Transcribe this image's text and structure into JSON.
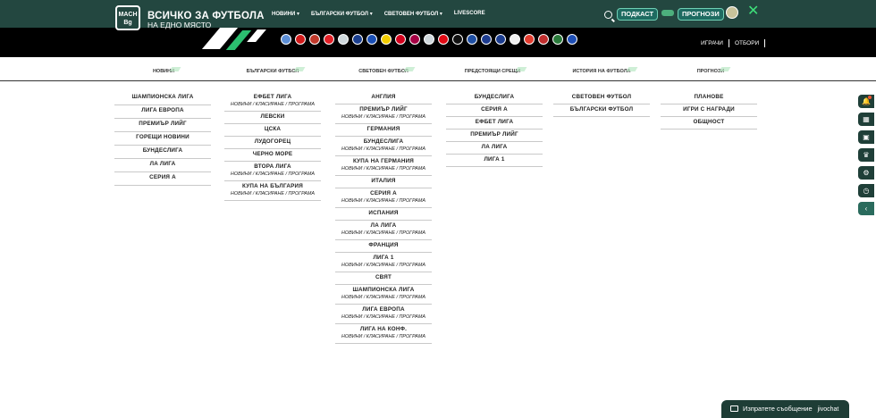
{
  "header": {
    "logo_line1": "MACH",
    "logo_line2": "Bg",
    "brand_title": "ВСИЧКО ЗА ФУТБОЛА",
    "brand_subtitle": "НА ЕДНО МЯСТО",
    "nav": [
      {
        "label": "НОВИНИ",
        "caret": "▾"
      },
      {
        "label": "БЪЛГАРСКИ ФУТБОЛ",
        "caret": "▾"
      },
      {
        "label": "СВЕТОВЕН ФУТБОЛ",
        "caret": "▾"
      },
      {
        "label": "LIVESCORE",
        "caret": ""
      }
    ],
    "podcast_label": "ПОДКАСТ",
    "prognosis_label": "ПРОГНОЗИ",
    "close_glyph": "✕",
    "accent_color": "#3ee07a",
    "bar_color": "#234740"
  },
  "club_bar": {
    "players_label": "ИГРАЧИ",
    "teams_label": "ОТБОРИ",
    "crest_colors": [
      "#5d8fd6",
      "#d11a1a",
      "#c0392b",
      "#e21f26",
      "#cfd8dc",
      "#1b3f8f",
      "#1a4fb5",
      "#f2cd00",
      "#d3001c",
      "#a50044",
      "#cfd8dc",
      "#e10a14",
      "#111111",
      "#1f4fa3",
      "#1e3c8f",
      "#1c3d8f",
      "#f0f0f0",
      "#e23b2e",
      "#c02e2e",
      "#2a7a3b",
      "#1f4fb5"
    ]
  },
  "subtabs": [
    "НОВИНИ",
    "БЪЛГАРСКИ ФУТБОЛ",
    "СВЕТОВЕН ФУТБОЛ",
    "ПРЕДСТОЯЩИ СРЕЩИ",
    "ИСТОРИЯ НА ФУТБОЛА",
    "ПРОГНОЗИ"
  ],
  "sub_links": "НОВИНИ / КЛАСИРАНЕ / ПРОГРАМА",
  "columns": [
    {
      "items": [
        {
          "title": "ШАМПИОНСКА ЛИГА"
        },
        {
          "title": "ЛИГА ЕВРОПА"
        },
        {
          "title": "ПРЕМИЪР ЛИЙГ"
        },
        {
          "title": "ГОРЕЩИ НОВИНИ"
        },
        {
          "title": "БУНДЕСЛИГА"
        },
        {
          "title": "ЛА ЛИГА"
        },
        {
          "title": "СЕРИЯ А"
        }
      ]
    },
    {
      "items": [
        {
          "title": "ЕФБЕТ ЛИГА",
          "sub": "НОВИНИ / КЛАСИРАНЕ / ПРОГРАМА"
        },
        {
          "title": "ЛЕВСКИ"
        },
        {
          "title": "ЦСКА"
        },
        {
          "title": "ЛУДОГОРЕЦ"
        },
        {
          "title": "ЧЕРНО МОРЕ"
        },
        {
          "title": "ВТОРА ЛИГА",
          "sub": "НОВИНИ / КЛАСИРАНЕ / ПРОГРАМА"
        },
        {
          "title": "КУПА НА БЪЛГАРИЯ",
          "sub": "НОВИНИ / КЛАСИРАНЕ / ПРОГРАМА"
        }
      ]
    },
    {
      "items": [
        {
          "title": "АНГЛИЯ"
        },
        {
          "title": "ПРЕМИЪР ЛИЙГ",
          "sub": "НОВИНИ / КЛАСИРАНЕ / ПРОГРАМА"
        },
        {
          "title": "ГЕРМАНИЯ"
        },
        {
          "title": "БУНДЕСЛИГА",
          "sub": "НОВИНИ / КЛАСИРАНЕ / ПРОГРАМА"
        },
        {
          "title": "КУПА НА ГЕРМАНИЯ",
          "sub": "НОВИНИ / КЛАСИРАНЕ / ПРОГРАМА"
        },
        {
          "title": "ИТАЛИЯ"
        },
        {
          "title": "СЕРИЯ А",
          "sub": "НОВИНИ / КЛАСИРАНЕ / ПРОГРАМА"
        },
        {
          "title": "ИСПАНИЯ"
        },
        {
          "title": "ЛА ЛИГА",
          "sub": "НОВИНИ / КЛАСИРАНЕ / ПРОГРАМА"
        },
        {
          "title": "ФРАНЦИЯ"
        },
        {
          "title": "ЛИГА 1",
          "sub": "НОВИНИ / КЛАСИРАНЕ / ПРОГРАМА"
        },
        {
          "title": "СВЯТ"
        },
        {
          "title": "ШАМПИОНСКА ЛИГА",
          "sub": "НОВИНИ / КЛАСИРАНЕ / ПРОГРАМА"
        },
        {
          "title": "ЛИГА ЕВРОПА",
          "sub": "НОВИНИ / КЛАСИРАНЕ / ПРОГРАМА"
        },
        {
          "title": "ЛИГА НА КОНФ.",
          "sub": "НОВИНИ / КЛАСИРАНЕ / ПРОГРАМА"
        }
      ]
    },
    {
      "items": [
        {
          "title": "БУНДЕСЛИГА"
        },
        {
          "title": "СЕРИЯ А"
        },
        {
          "title": "ЕФБЕТ ЛИГА"
        },
        {
          "title": "ПРЕМИЪР ЛИЙГ"
        },
        {
          "title": "ЛА ЛИГА"
        },
        {
          "title": "ЛИГА 1"
        }
      ]
    },
    {
      "items": [
        {
          "title": "СВЕТОВЕН ФУТБОЛ"
        },
        {
          "title": "БЪЛГАРСКИ ФУТБОЛ"
        }
      ]
    },
    {
      "items": [
        {
          "title": "ПЛАНОВЕ"
        },
        {
          "title": "ИГРИ С НАГРАДИ"
        },
        {
          "title": "ОБЩНОСТ"
        }
      ]
    }
  ],
  "dock": [
    {
      "icon": "bell-icon",
      "glyph": "🔔"
    },
    {
      "icon": "calendar-icon",
      "glyph": "▦"
    },
    {
      "icon": "scoreboard-icon",
      "glyph": "▣"
    },
    {
      "icon": "trophy-icon",
      "glyph": "♛"
    },
    {
      "icon": "gear-icon",
      "glyph": "⚙"
    },
    {
      "icon": "clock-icon",
      "glyph": "◷"
    },
    {
      "icon": "collapse-icon",
      "glyph": "‹"
    }
  ],
  "chat": {
    "label": "Изпратете съобщение",
    "brand": "jivochat"
  }
}
